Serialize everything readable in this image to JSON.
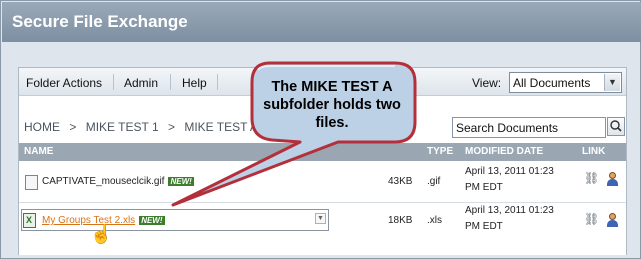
{
  "app": {
    "title": "Secure File Exchange"
  },
  "menu": {
    "items": [
      "Folder Actions",
      "Admin",
      "Help"
    ],
    "view_label": "View:",
    "view_value": "All Documents"
  },
  "breadcrumb": [
    "HOME",
    "MIKE TEST 1",
    "MIKE TEST A"
  ],
  "breadcrumb_sep": ">",
  "search": {
    "value": "Search Documents"
  },
  "columns": {
    "name": "NAME",
    "type": "TYPE",
    "modified": "MODIFIED DATE",
    "link": "LINK"
  },
  "files": [
    {
      "name": "CAPTIVATE_mouseclcik.gif",
      "badge": "NEW!",
      "size": "43KB",
      "type": ".gif",
      "date": "April 13, 2011 01:23 PM EDT"
    },
    {
      "name": "My Groups Test 2.xls",
      "badge": "NEW!",
      "size": "18KB",
      "type": ".xls",
      "date": "April 13, 2011 01:23 PM EDT"
    }
  ],
  "callout": {
    "text": "The MIKE TEST A subfolder holds two files."
  },
  "colors": {
    "title_bar": "#7d8fa2",
    "header_row": "#9aa6b2",
    "callout_fill": "#bcd0e6",
    "callout_border": "#b3303a",
    "link_orange": "#d9731a",
    "new_badge": "#3d7d2b"
  }
}
